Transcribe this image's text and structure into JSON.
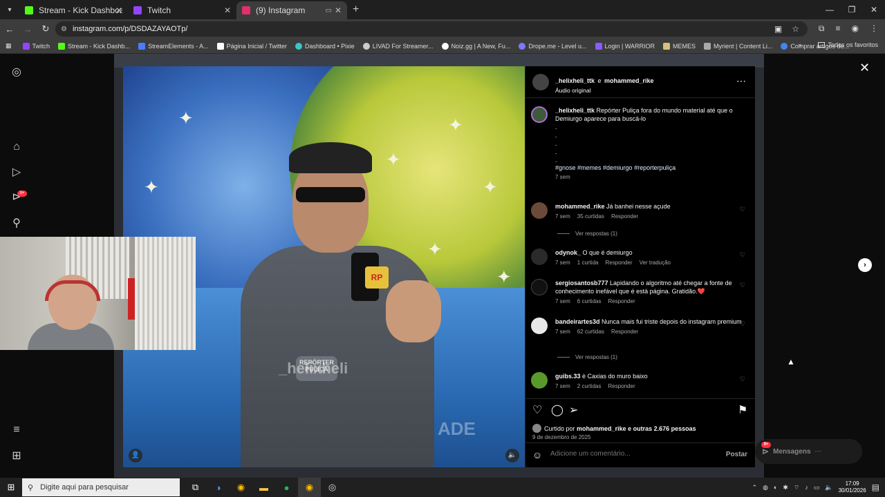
{
  "browser": {
    "tabs": [
      {
        "label": "Stream - Kick Dashboard",
        "color": "#53fc18"
      },
      {
        "label": "Twitch",
        "color": "#9146ff"
      },
      {
        "label": "(9) Instagram",
        "color": "#e1306c"
      }
    ],
    "url": "instagram.com/p/DSDAZAYAOTp/",
    "bookmarks": [
      {
        "label": "Twitch",
        "color": "#9146ff"
      },
      {
        "label": "Stream - Kick Dashb...",
        "color": "#53fc18"
      },
      {
        "label": "StreamElements - A...",
        "color": "#4a7cff"
      },
      {
        "label": "Página Inicial / Twitter",
        "color": "#ffffff"
      },
      {
        "label": "Dashboard • Pixie",
        "color": "#3ac6c6"
      },
      {
        "label": "LIVAD For Streamer...",
        "color": "#cccccc"
      },
      {
        "label": "Noiz.gg | A New, Fu...",
        "color": "#ffffff"
      },
      {
        "label": "Drope.me - Level u...",
        "color": "#7a7aff"
      },
      {
        "label": "Login | WARRIOR",
        "color": "#8a5cff"
      },
      {
        "label": "MEMES",
        "color": "#d8c07a"
      },
      {
        "label": "Myrient | Content Li...",
        "color": "#aaaaaa"
      },
      {
        "label": "Comprar artigos de...",
        "color": "#4285f4"
      }
    ],
    "all_favorites": "Todos os favoritos"
  },
  "post": {
    "header_user1": "_helixheli_ttk",
    "header_and": "e",
    "header_user2": "mohammed_rike",
    "audio": "Áudio original",
    "caption_user": "_helixheli_ttk",
    "caption_text": "Repórter Puliça fora do mundo material até que o Demiurgo aparece para buscá-lo",
    "dots": [
      ".",
      ".",
      ".",
      ".",
      "."
    ],
    "hashtags": "#gnose #memes #demiurgo #reporterpuliça",
    "caption_time": "7 sem",
    "comments": [
      {
        "user": "mohammed_rike",
        "text": "Já banhei nesse açude",
        "time": "7 sem",
        "likes": "35 curtidas",
        "reply": "Responder",
        "extra": ""
      },
      {
        "user": "odynok_",
        "text": "O que é demiurgo",
        "time": "7 sem",
        "likes": "1 curtida",
        "reply": "Responder",
        "extra": "Ver tradução"
      },
      {
        "user": "sergiosantosb777",
        "text": "Lapidando o algoritmo até chegar a fonte de conhecimento inefável que é está página. Gratidão.❤️",
        "time": "7 sem",
        "likes": "6 curtidas",
        "reply": "Responder",
        "extra": ""
      },
      {
        "user": "bandeirartes3d",
        "text": "Nunca mais fui triste depois do instagram premium",
        "time": "7 sem",
        "likes": "62 curtidas",
        "reply": "Responder",
        "extra": ""
      },
      {
        "user": "guibs.33",
        "text": "è Caxias do muro baixo",
        "time": "7 sem",
        "likes": "2 curtidas",
        "reply": "Responder",
        "extra": ""
      }
    ],
    "view_replies_1": "Ver respostas (1)",
    "view_replies_2": "Ver respostas (1)",
    "liked_prefix": "Curtido por",
    "liked_user": "mohammed_rike",
    "liked_suffix": "e outras 2.676 pessoas",
    "date": "9 de dezembro de 2025",
    "comment_placeholder": "Adicione um comentário...",
    "post_button": "Postar"
  },
  "video": {
    "mic_flag": "RP",
    "badge": "REPÓRTER PULIÇA",
    "watermark": "_helixheli",
    "watermark2": "ADE"
  },
  "messages": "Mensagens",
  "messages_badge": "9+",
  "notif_badge": "9+",
  "taskbar": {
    "search_placeholder": "Digite aqui para pesquisar",
    "time": "17:09",
    "date": "30/01/2026"
  }
}
